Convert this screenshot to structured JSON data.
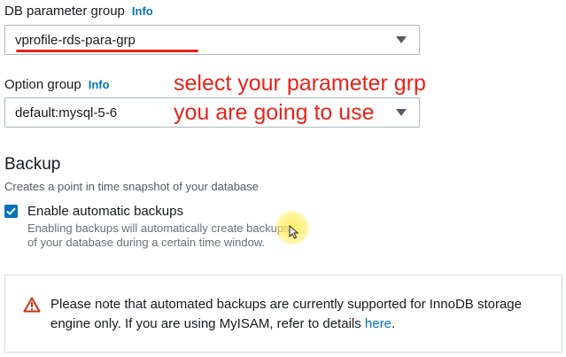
{
  "parameter_group": {
    "label": "DB parameter group",
    "info": "Info",
    "selected": "vprofile-rds-para-grp"
  },
  "option_group": {
    "label": "Option group",
    "info": "Info",
    "selected": "default:mysql-5-6"
  },
  "annotation": {
    "line1": "select your parameter grp",
    "line2": "you are going to use",
    "color": "#e8231a"
  },
  "backup": {
    "title": "Backup",
    "description": "Creates a point in time snapshot of your database",
    "checkbox_label": "Enable automatic backups",
    "checkbox_checked": true,
    "checkbox_desc_line1": "Enabling backups will automatically create backups",
    "checkbox_desc_line2": "of your database during a certain time window."
  },
  "alert": {
    "icon": "warning-triangle-icon",
    "text": "Please note that automated backups are currently supported for InnoDB storage engine only. If you are using MyISAM, refer to details ",
    "link": "here",
    "end": "."
  },
  "colors": {
    "accent": "#0073bb",
    "warning": "#d13212"
  }
}
